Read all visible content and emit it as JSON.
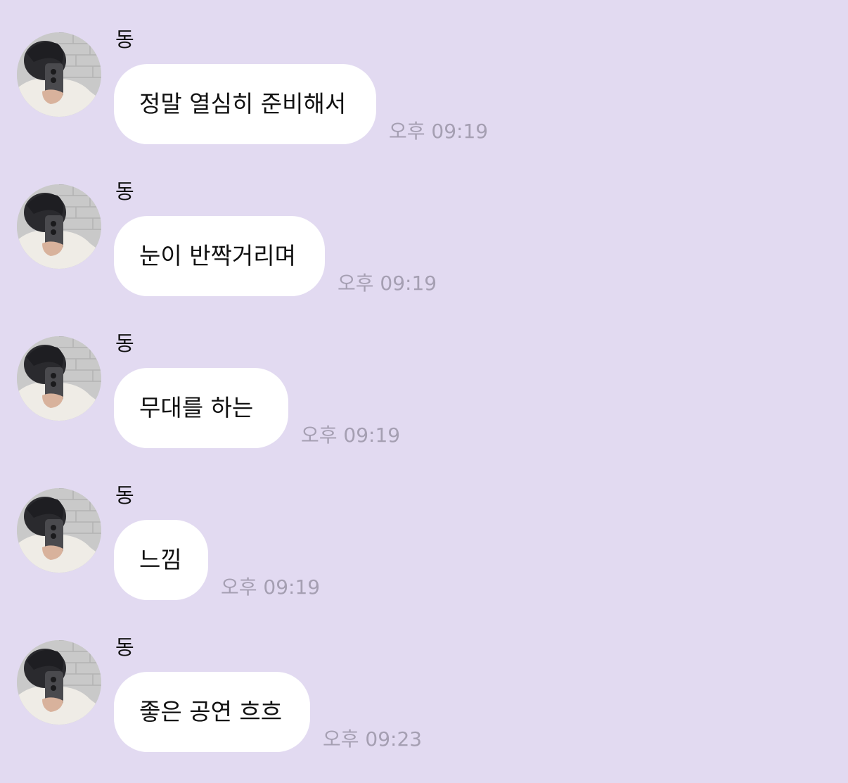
{
  "chat": {
    "messages": [
      {
        "sender": "동",
        "avatar_icon": "profile-photo-icon",
        "text": "정말 열심히 준비해서",
        "time": "오후 09:19"
      },
      {
        "sender": "동",
        "avatar_icon": "profile-photo-icon",
        "text": "눈이 반짝거리며",
        "time": "오후 09:19"
      },
      {
        "sender": "동",
        "avatar_icon": "profile-photo-icon",
        "text": "무대를 하는",
        "time": "오후 09:19"
      },
      {
        "sender": "동",
        "avatar_icon": "profile-photo-icon",
        "text": "느낌",
        "time": "오후 09:19"
      },
      {
        "sender": "동",
        "avatar_icon": "profile-photo-icon",
        "text": "좋은 공연 흐흐",
        "time": "오후 09:23"
      }
    ]
  },
  "colors": {
    "background": "#e2daf1",
    "bubble": "#ffffff",
    "timestamp": "#a59fb2",
    "text": "#111111"
  }
}
